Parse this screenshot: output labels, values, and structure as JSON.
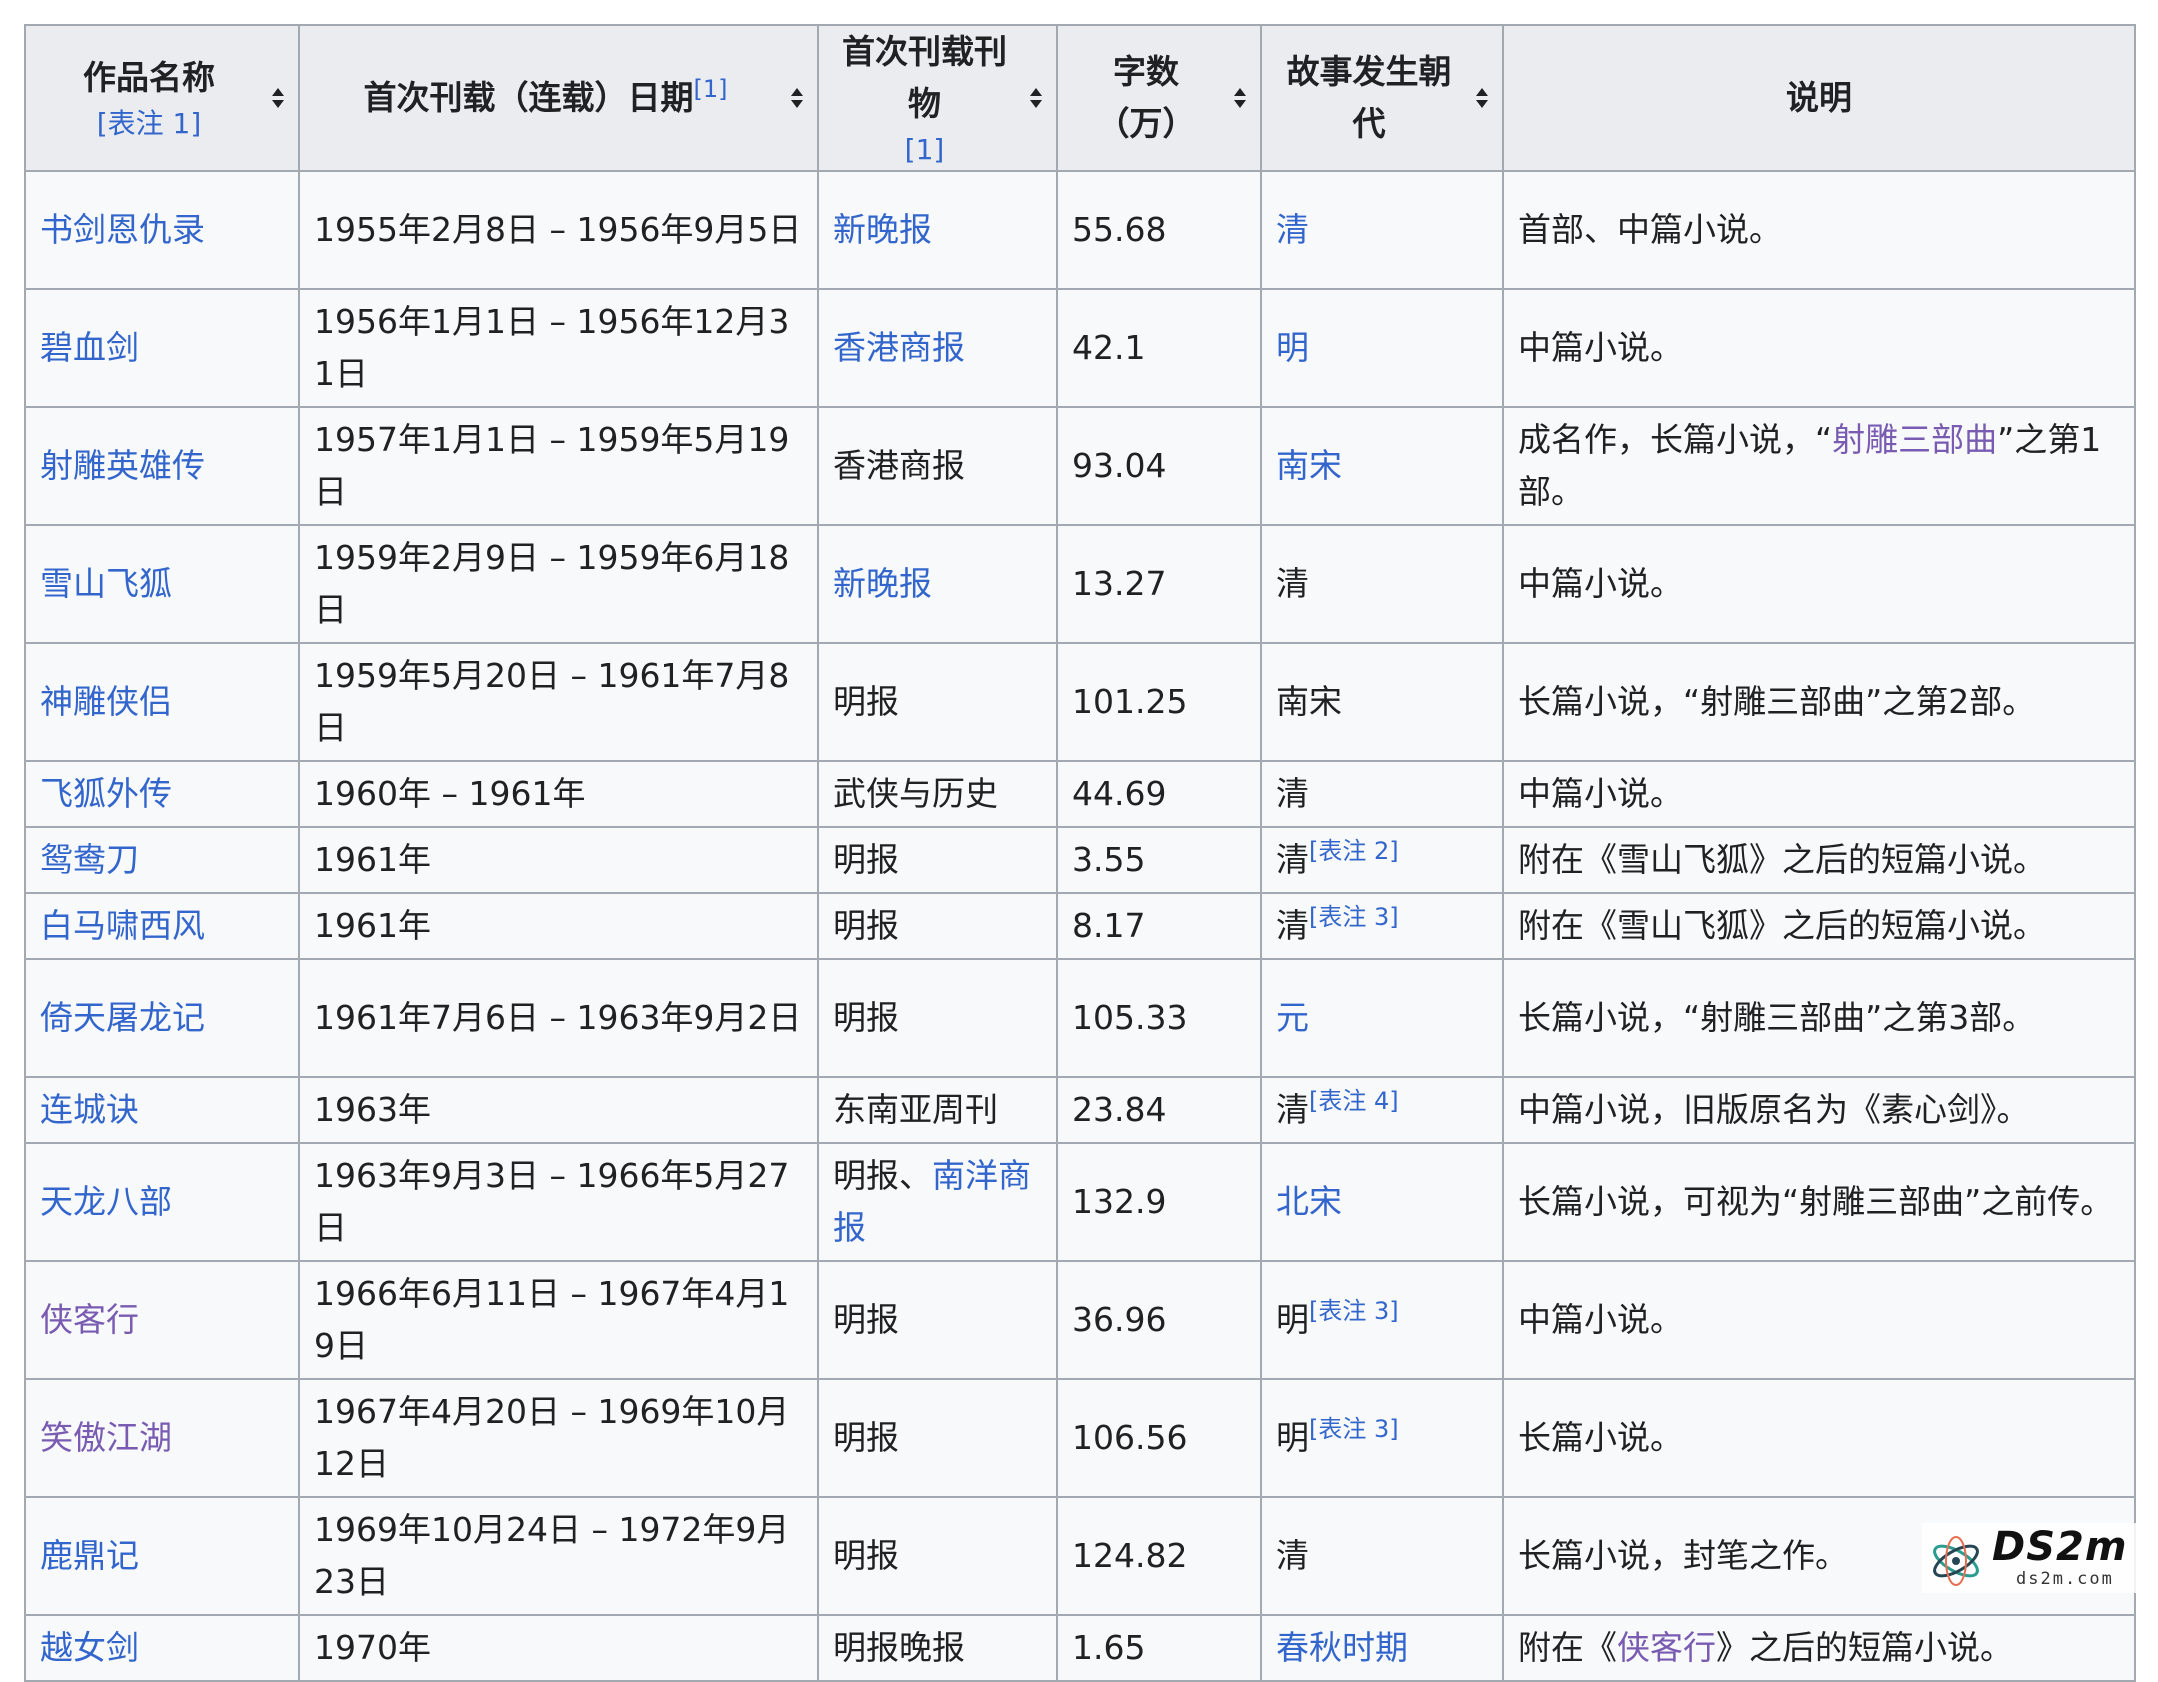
{
  "headers": [
    {
      "label": "作品名称",
      "note": "[表注 1]",
      "ref": "",
      "sortable": true
    },
    {
      "label": "首次刊载（连载）日期",
      "note": "",
      "ref": "[1]",
      "sortable": true
    },
    {
      "label": "首次刊载刊物",
      "note": "[1]",
      "ref": "",
      "sortable": true
    },
    {
      "label": "字数（万）",
      "note": "",
      "ref": "",
      "sortable": true
    },
    {
      "label": "故事发生朝代",
      "note": "",
      "ref": "",
      "sortable": true
    },
    {
      "label": "说明",
      "note": "",
      "ref": "",
      "sortable": false
    }
  ],
  "rows": [
    {
      "title": "书剑恩仇录",
      "date": "1955年2月8日 – 1956年9月5日",
      "pub": "新晚报",
      "words": "55.68",
      "dynasty": "清",
      "dynasty_note": "",
      "desc_pre": "首部、中篇小说。",
      "desc_link": "",
      "desc_post": ""
    },
    {
      "title": "碧血剑",
      "date": "1956年1月1日 – 1956年12月31日",
      "pub": "香港商报",
      "words": "42.1",
      "dynasty": "明",
      "dynasty_note": "",
      "desc_pre": "中篇小说。",
      "desc_link": "",
      "desc_post": ""
    },
    {
      "title": "射雕英雄传",
      "date": "1957年1月1日 – 1959年5月19日",
      "pub": "香港商报",
      "words": "93.04",
      "dynasty": "南宋",
      "dynasty_note": "",
      "desc_pre": "成名作，长篇小说，“",
      "desc_link": "射雕三部曲",
      "desc_post": "”之第1部。"
    },
    {
      "title": "雪山飞狐",
      "date": "1959年2月9日 – 1959年6月18日",
      "pub": "新晚报",
      "words": "13.27",
      "dynasty": "清",
      "dynasty_note": "",
      "desc_pre": "中篇小说。",
      "desc_link": "",
      "desc_post": ""
    },
    {
      "title": "神雕侠侣",
      "date": "1959年5月20日 – 1961年7月8日",
      "pub": "明报",
      "words": "101.25",
      "dynasty": "南宋",
      "dynasty_note": "",
      "desc_pre": "长篇小说，“射雕三部曲”之第2部。",
      "desc_link": "",
      "desc_post": ""
    },
    {
      "title": "飞狐外传",
      "date": "1960年 – 1961年",
      "pub": "武侠与历史",
      "words": "44.69",
      "dynasty": "清",
      "dynasty_note": "",
      "desc_pre": "中篇小说。",
      "desc_link": "",
      "desc_post": ""
    },
    {
      "title": "鸳鸯刀",
      "date": "1961年",
      "pub": "明报",
      "words": "3.55",
      "dynasty": "清",
      "dynasty_note": "[表注 2]",
      "desc_pre": "附在《雪山飞狐》之后的短篇小说。",
      "desc_link": "",
      "desc_post": ""
    },
    {
      "title": "白马啸西风",
      "date": "1961年",
      "pub": "明报",
      "words": "8.17",
      "dynasty": "清",
      "dynasty_note": "[表注 3]",
      "desc_pre": "附在《雪山飞狐》之后的短篇小说。",
      "desc_link": "",
      "desc_post": ""
    },
    {
      "title": "倚天屠龙记",
      "date": "1961年7月6日 – 1963年9月2日",
      "pub": "明报",
      "words": "105.33",
      "dynasty": "元",
      "dynasty_note": "",
      "desc_pre": "长篇小说，“射雕三部曲”之第3部。",
      "desc_link": "",
      "desc_post": ""
    },
    {
      "title": "连城诀",
      "date": "1963年",
      "pub": "东南亚周刊",
      "words": "23.84",
      "dynasty": "清",
      "dynasty_note": "[表注 4]",
      "desc_pre": "中篇小说，旧版原名为《素心剑》。",
      "desc_link": "",
      "desc_post": ""
    },
    {
      "title": "天龙八部",
      "date": "1963年9月3日 – 1966年5月27日",
      "pub_pre": "明报、",
      "pub": "南洋商报",
      "words": "132.9",
      "dynasty": "北宋",
      "dynasty_note": "",
      "desc_pre": "长篇小说，可视为“射雕三部曲”之前传。",
      "desc_link": "",
      "desc_post": ""
    },
    {
      "title": "侠客行",
      "date": "1966年6月11日 – 1967年4月19日",
      "pub": "明报",
      "words": "36.96",
      "dynasty": "明",
      "dynasty_note": "[表注 3]",
      "desc_pre": "中篇小说。",
      "desc_link": "",
      "desc_post": ""
    },
    {
      "title": "笑傲江湖",
      "date": "1967年4月20日 – 1969年10月12日",
      "pub": "明报",
      "words": "106.56",
      "dynasty": "明",
      "dynasty_note": "[表注 3]",
      "desc_pre": "长篇小说。",
      "desc_link": "",
      "desc_post": ""
    },
    {
      "title": "鹿鼎记",
      "date": "1969年10月24日 – 1972年9月23日",
      "pub": "明报",
      "words": "124.82",
      "dynasty": "清",
      "dynasty_note": "",
      "desc_pre": "长篇小说，封笔之作。",
      "desc_link": "",
      "desc_post": ""
    },
    {
      "title": "越女剑",
      "date": "1970年",
      "pub": "明报晚报",
      "words": "1.65",
      "dynasty": "春秋时期",
      "dynasty_note": "",
      "desc_pre": "附在《",
      "desc_link": "侠客行",
      "desc_post": "》之后的短篇小说。"
    }
  ],
  "watermark": {
    "text": "DS2m",
    "sub": "ds2m.com"
  },
  "colors": {
    "link": "#3366cc",
    "visited": "#795cb2",
    "header_bg": "#eaecf0",
    "cell_bg": "#f8f9fa",
    "border": "#a2a9b1"
  }
}
